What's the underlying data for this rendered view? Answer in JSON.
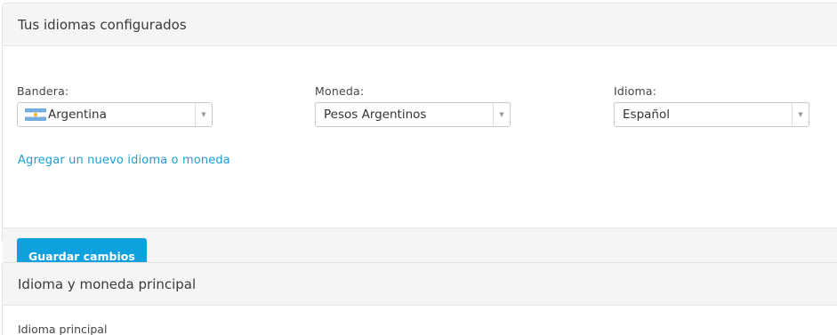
{
  "configured": {
    "title": "Tus idiomas configurados",
    "flag_label": "Bandera:",
    "flag_value": "Argentina",
    "flag_icon": "argentina-flag-icon",
    "currency_label": "Moneda:",
    "currency_value": "Pesos Argentinos",
    "language_label": "Idioma:",
    "language_value": "Español",
    "add_link": "Agregar un nuevo idioma o moneda",
    "save_button": "Guardar cambios"
  },
  "main_language": {
    "title": "Idioma y moneda principal",
    "label": "Idioma principal"
  },
  "colors": {
    "accent": "#0fa0de",
    "link": "#1a9fd4",
    "header_bg": "#f5f5f5"
  }
}
